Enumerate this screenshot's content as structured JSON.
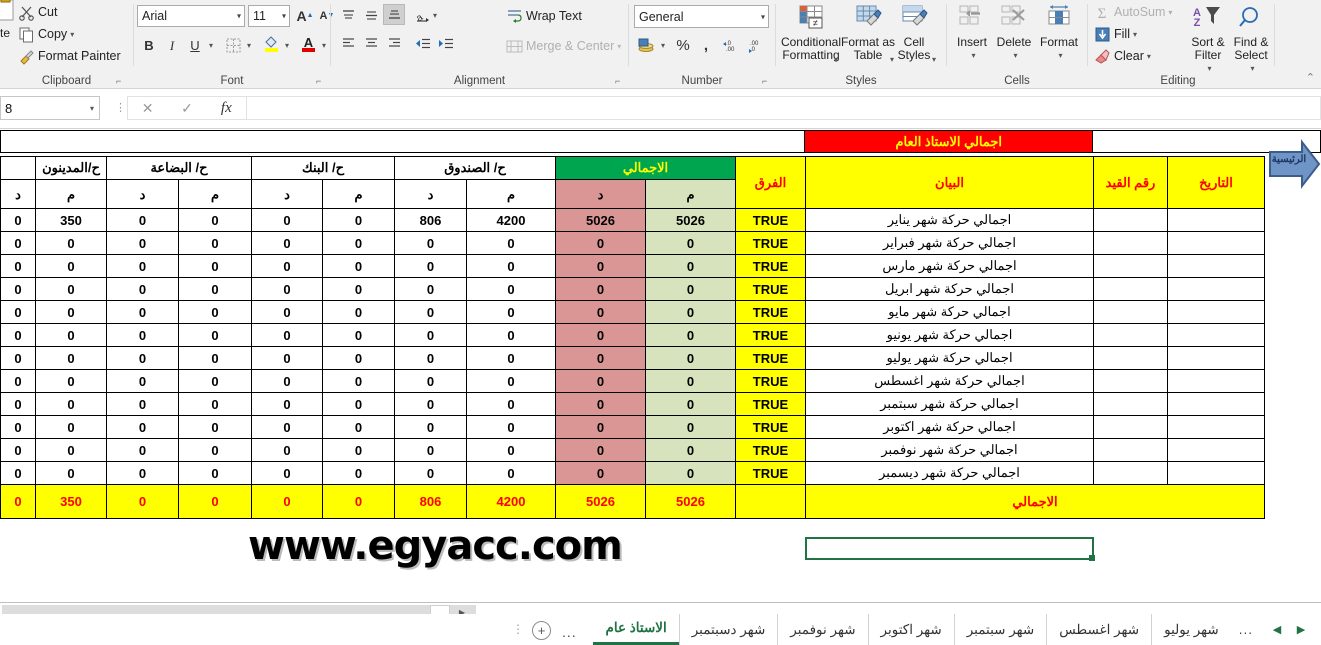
{
  "ribbon": {
    "clipboard": {
      "label": "Clipboard",
      "cut": "Cut",
      "copy": "Copy",
      "format_painter": "Format Painter"
    },
    "font": {
      "label": "Font",
      "font_name": "Arial",
      "font_size": "11",
      "grow_font": "A",
      "shrink_font": "A",
      "bold": "B",
      "italic": "I",
      "underline": "U"
    },
    "alignment": {
      "label": "Alignment",
      "wrap_text": "Wrap Text",
      "merge_center": "Merge & Center"
    },
    "number": {
      "label": "Number",
      "format": "General",
      "percent": "%",
      "comma": ","
    },
    "styles": {
      "label": "Styles",
      "conditional_formatting": "Conditional Formatting",
      "format_as_table": "Format as Table",
      "cell_styles": "Cell Styles"
    },
    "cells": {
      "label": "Cells",
      "insert": "Insert",
      "delete": "Delete",
      "format": "Format"
    },
    "editing": {
      "label": "Editing",
      "autosum": "AutoSum",
      "fill": "Fill",
      "clear": "Clear",
      "sort_filter": "Sort & Filter",
      "find_select": "Find & Select"
    }
  },
  "formula_bar": {
    "name_box": "8",
    "cancel": "✕",
    "enter": "✓",
    "fx": "fx",
    "formula_value": ""
  },
  "sheet": {
    "banner": "اجمالي الاستاذ العام",
    "home_button": "الرئيسية",
    "group_headers": [
      "ح/المدينون",
      "ح/ البضاعة",
      "ح/ البنك",
      "ح/ الصندوق",
      "الاجمالي"
    ],
    "sub_d": "د",
    "sub_m": "م",
    "col_farq": "الفرق",
    "col_bayan": "البيان",
    "col_raqm_qaid": "رقم القيد",
    "col_tarikh": "التاريخ",
    "total_label": "الاجمالي",
    "true_value": "TRUE",
    "watermark": "www.egyacc.com",
    "rows": [
      {
        "desc": "اجمالي  حركة شهر يناير",
        "madinun_d": "0",
        "madinun_m": "350",
        "bidaa_d": "0",
        "bidaa_m": "0",
        "bank_d": "0",
        "bank_m": "0",
        "sandouq_d": "806",
        "sandouq_m": "4200",
        "total_d": "5026",
        "total_m": "5026",
        "farq": "TRUE",
        "raqm": "",
        "tarikh": ""
      },
      {
        "desc": "اجمالي  حركة شهر فبراير",
        "madinun_d": "0",
        "madinun_m": "0",
        "bidaa_d": "0",
        "bidaa_m": "0",
        "bank_d": "0",
        "bank_m": "0",
        "sandouq_d": "0",
        "sandouq_m": "0",
        "total_d": "0",
        "total_m": "0",
        "farq": "TRUE",
        "raqm": "",
        "tarikh": ""
      },
      {
        "desc": "اجمالي  حركة شهر مارس",
        "madinun_d": "0",
        "madinun_m": "0",
        "bidaa_d": "0",
        "bidaa_m": "0",
        "bank_d": "0",
        "bank_m": "0",
        "sandouq_d": "0",
        "sandouq_m": "0",
        "total_d": "0",
        "total_m": "0",
        "farq": "TRUE",
        "raqm": "",
        "tarikh": ""
      },
      {
        "desc": "اجمالي  حركة شهر ابريل",
        "madinun_d": "0",
        "madinun_m": "0",
        "bidaa_d": "0",
        "bidaa_m": "0",
        "bank_d": "0",
        "bank_m": "0",
        "sandouq_d": "0",
        "sandouq_m": "0",
        "total_d": "0",
        "total_m": "0",
        "farq": "TRUE",
        "raqm": "",
        "tarikh": ""
      },
      {
        "desc": "اجمالي  حركة شهر مايو",
        "madinun_d": "0",
        "madinun_m": "0",
        "bidaa_d": "0",
        "bidaa_m": "0",
        "bank_d": "0",
        "bank_m": "0",
        "sandouq_d": "0",
        "sandouq_m": "0",
        "total_d": "0",
        "total_m": "0",
        "farq": "TRUE",
        "raqm": "",
        "tarikh": ""
      },
      {
        "desc": "اجمالي  حركة شهر يونيو",
        "madinun_d": "0",
        "madinun_m": "0",
        "bidaa_d": "0",
        "bidaa_m": "0",
        "bank_d": "0",
        "bank_m": "0",
        "sandouq_d": "0",
        "sandouq_m": "0",
        "total_d": "0",
        "total_m": "0",
        "farq": "TRUE",
        "raqm": "",
        "tarikh": ""
      },
      {
        "desc": "اجمالي  حركة شهر يوليو",
        "madinun_d": "0",
        "madinun_m": "0",
        "bidaa_d": "0",
        "bidaa_m": "0",
        "bank_d": "0",
        "bank_m": "0",
        "sandouq_d": "0",
        "sandouq_m": "0",
        "total_d": "0",
        "total_m": "0",
        "farq": "TRUE",
        "raqm": "",
        "tarikh": ""
      },
      {
        "desc": "اجمالي  حركة شهر اغسطس",
        "madinun_d": "0",
        "madinun_m": "0",
        "bidaa_d": "0",
        "bidaa_m": "0",
        "bank_d": "0",
        "bank_m": "0",
        "sandouq_d": "0",
        "sandouq_m": "0",
        "total_d": "0",
        "total_m": "0",
        "farq": "TRUE",
        "raqm": "",
        "tarikh": ""
      },
      {
        "desc": "اجمالي  حركة شهر سبتمبر",
        "madinun_d": "0",
        "madinun_m": "0",
        "bidaa_d": "0",
        "bidaa_m": "0",
        "bank_d": "0",
        "bank_m": "0",
        "sandouq_d": "0",
        "sandouq_m": "0",
        "total_d": "0",
        "total_m": "0",
        "farq": "TRUE",
        "raqm": "",
        "tarikh": ""
      },
      {
        "desc": "اجمالي  حركة شهر اكتوبر",
        "madinun_d": "0",
        "madinun_m": "0",
        "bidaa_d": "0",
        "bidaa_m": "0",
        "bank_d": "0",
        "bank_m": "0",
        "sandouq_d": "0",
        "sandouq_m": "0",
        "total_d": "0",
        "total_m": "0",
        "farq": "TRUE",
        "raqm": "",
        "tarikh": ""
      },
      {
        "desc": "اجمالي  حركة شهر نوفمبر",
        "madinun_d": "0",
        "madinun_m": "0",
        "bidaa_d": "0",
        "bidaa_m": "0",
        "bank_d": "0",
        "bank_m": "0",
        "sandouq_d": "0",
        "sandouq_m": "0",
        "total_d": "0",
        "total_m": "0",
        "farq": "TRUE",
        "raqm": "",
        "tarikh": ""
      },
      {
        "desc": "اجمالي  حركة شهر ديسمبر",
        "madinun_d": "0",
        "madinun_m": "0",
        "bidaa_d": "0",
        "bidaa_m": "0",
        "bank_d": "0",
        "bank_m": "0",
        "sandouq_d": "0",
        "sandouq_m": "0",
        "total_d": "0",
        "total_m": "0",
        "farq": "TRUE",
        "raqm": "",
        "tarikh": ""
      }
    ],
    "totals": {
      "madinun_d": "0",
      "madinun_m": "350",
      "bidaa_d": "0",
      "bidaa_m": "0",
      "bank_d": "0",
      "bank_m": "0",
      "sandouq_d": "806",
      "sandouq_m": "4200",
      "total_d": "5026",
      "total_m": "5026"
    }
  },
  "tabs": {
    "add_sheet": "+",
    "left_ellipsis": "...",
    "right_ellipsis": "...",
    "prev_arrow": "◀",
    "next_arrow": "▶",
    "items": [
      {
        "label": "شهر يوليو",
        "active": false
      },
      {
        "label": "شهر اغسطس",
        "active": false
      },
      {
        "label": "شهر سبتمبر",
        "active": false
      },
      {
        "label": "شهر اكتوبر",
        "active": false
      },
      {
        "label": "شهر نوفمبر",
        "active": false
      },
      {
        "label": "شهر دسبتمبر",
        "active": false
      },
      {
        "label": "الاستاذ عام",
        "active": true
      }
    ]
  },
  "colors": {
    "banner_red": "#ff0000",
    "header_yellow": "#ffff00",
    "header_green": "#00a550",
    "debit_red": "#d99694",
    "credit_green": "#d6e3bc",
    "text_red": "#ff0000",
    "excel_green": "#217346"
  }
}
